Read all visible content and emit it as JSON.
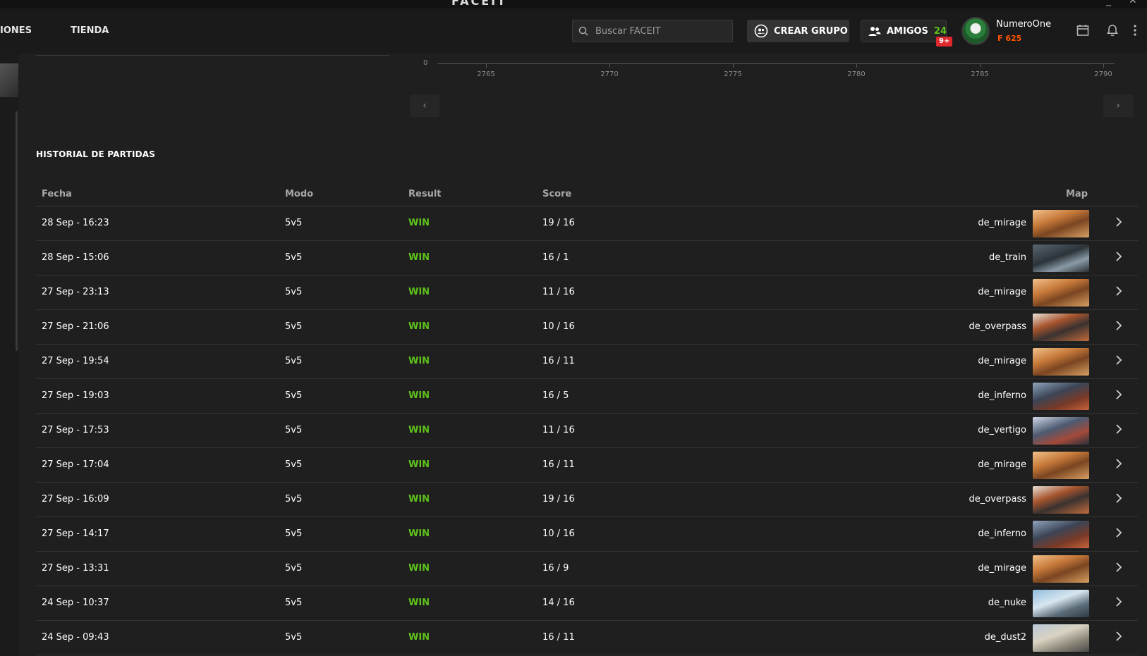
{
  "window": {
    "brand": "FACEIT"
  },
  "nav": {
    "left_item_partial": "IONES",
    "shop": "TIENDA"
  },
  "search": {
    "placeholder": "Buscar FACEIT"
  },
  "actions": {
    "create_group": "CREAR GRUPO",
    "friends": "AMIGOS",
    "friends_count": "24",
    "notifications_badge": "9+"
  },
  "user": {
    "name": "NumeroOne",
    "points": "625"
  },
  "chart": {
    "zero_label": "0",
    "x_ticks": [
      "2765",
      "2770",
      "2775",
      "2780",
      "2785",
      "2790"
    ]
  },
  "pager": {
    "prev": "‹",
    "next": "›"
  },
  "history": {
    "title": "HISTORIAL DE PARTIDAS",
    "columns": {
      "date": "Fecha",
      "mode": "Modo",
      "result": "Result",
      "score": "Score",
      "map": "Map"
    },
    "rows": [
      {
        "date": "28 Sep - 16:23",
        "mode": "5v5",
        "result": "WIN",
        "score": "19 / 16",
        "map": "de_mirage"
      },
      {
        "date": "28 Sep - 15:06",
        "mode": "5v5",
        "result": "WIN",
        "score": "16 / 1",
        "map": "de_train"
      },
      {
        "date": "27 Sep - 23:13",
        "mode": "5v5",
        "result": "WIN",
        "score": "11 / 16",
        "map": "de_mirage"
      },
      {
        "date": "27 Sep - 21:06",
        "mode": "5v5",
        "result": "WIN",
        "score": "10 / 16",
        "map": "de_overpass"
      },
      {
        "date": "27 Sep - 19:54",
        "mode": "5v5",
        "result": "WIN",
        "score": "16 / 11",
        "map": "de_mirage"
      },
      {
        "date": "27 Sep - 19:03",
        "mode": "5v5",
        "result": "WIN",
        "score": "16 / 5",
        "map": "de_inferno"
      },
      {
        "date": "27 Sep - 17:53",
        "mode": "5v5",
        "result": "WIN",
        "score": "11 / 16",
        "map": "de_vertigo"
      },
      {
        "date": "27 Sep - 17:04",
        "mode": "5v5",
        "result": "WIN",
        "score": "16 / 11",
        "map": "de_mirage"
      },
      {
        "date": "27 Sep - 16:09",
        "mode": "5v5",
        "result": "WIN",
        "score": "19 / 16",
        "map": "de_overpass"
      },
      {
        "date": "27 Sep - 14:17",
        "mode": "5v5",
        "result": "WIN",
        "score": "10 / 16",
        "map": "de_inferno"
      },
      {
        "date": "27 Sep - 13:31",
        "mode": "5v5",
        "result": "WIN",
        "score": "16 / 9",
        "map": "de_mirage"
      },
      {
        "date": "24 Sep - 10:37",
        "mode": "5v5",
        "result": "WIN",
        "score": "14 / 16",
        "map": "de_nuke"
      },
      {
        "date": "24 Sep - 09:43",
        "mode": "5v5",
        "result": "WIN",
        "score": "16 / 11",
        "map": "de_dust2"
      }
    ]
  },
  "colors": {
    "win": "#5ec21a",
    "accent": "#ff5500",
    "badge": "#e0292f"
  }
}
